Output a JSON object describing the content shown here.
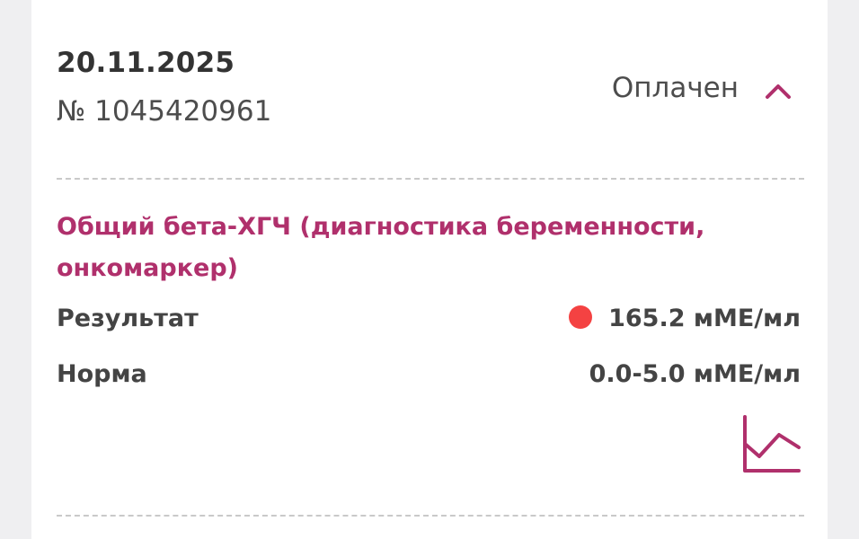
{
  "order": {
    "date": "20.11.2025",
    "number": "№ 1045420961",
    "status": "Оплачен",
    "toggle_icon": "chevron-up-icon"
  },
  "test": {
    "name": "Общий бета-ХГЧ (диагностика беременности, онкомаркер)",
    "result_label": "Результат",
    "result_value": "165.2 мМЕ/мл",
    "result_status_color": "#f44242",
    "norm_label": "Норма",
    "norm_value": "0.0-5.0 мМЕ/мл",
    "chart_icon": "line-chart-icon"
  },
  "colors": {
    "accent": "#b0306c",
    "text": "#444444",
    "background": "#efeff1",
    "card": "#ffffff"
  }
}
